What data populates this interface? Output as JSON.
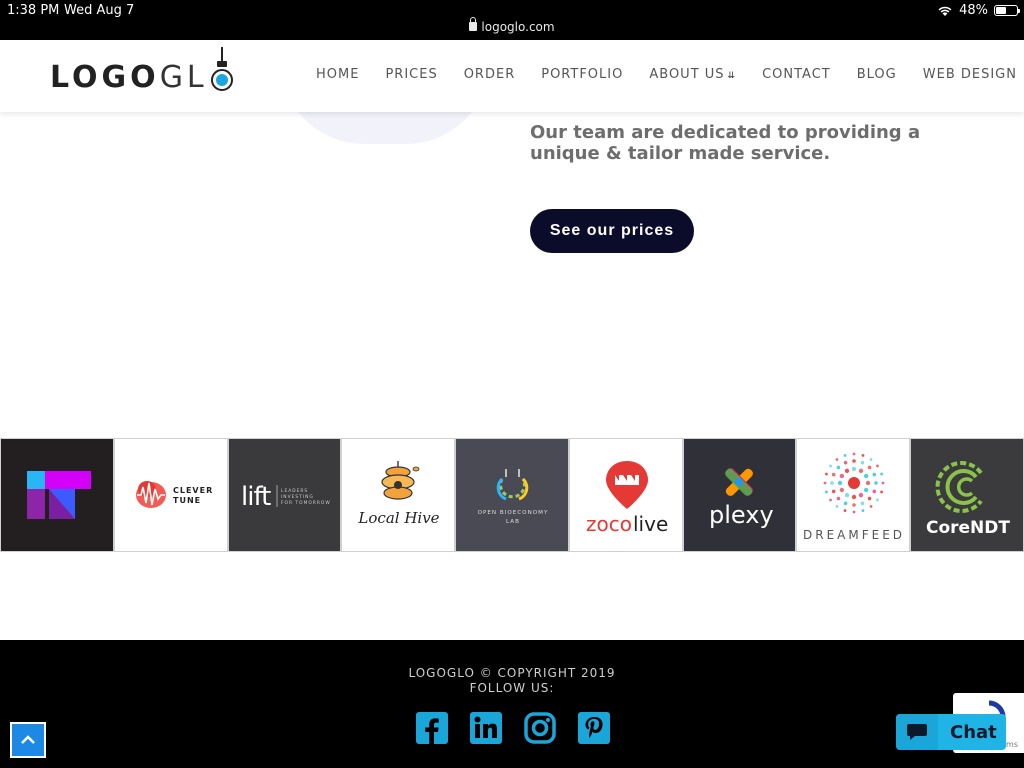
{
  "status_bar": {
    "time": "1:38 PM",
    "date": "Wed Aug 7",
    "url": "logoglo.com",
    "battery": "48%",
    "battery_level": 0.48
  },
  "header": {
    "logo_bold": "LOGO",
    "logo_light": "GL",
    "nav": [
      {
        "label": "HOME"
      },
      {
        "label": "PRICES"
      },
      {
        "label": "ORDER"
      },
      {
        "label": "PORTFOLIO"
      },
      {
        "label": "ABOUT US",
        "has_dropdown": true
      },
      {
        "label": "CONTACT"
      },
      {
        "label": "BLOG"
      },
      {
        "label": "WEB DESIGN"
      }
    ]
  },
  "hero": {
    "tagline": "Our team are dedicated to providing a unique & tailor made service.",
    "cta_label": "See our prices"
  },
  "portfolio_logos": [
    {
      "name": "IT",
      "bg": "#231f20"
    },
    {
      "name": "CLEVER TUNE",
      "bg": "#ffffff"
    },
    {
      "name": "lift",
      "sub": "LEADERS INVESTING FOR TOMORROW",
      "bg": "#3a3a3c"
    },
    {
      "name": "Local Hive",
      "bg": "#ffffff"
    },
    {
      "name": "OPEN BIOECONOMY LAB",
      "bg": "#4a4a55"
    },
    {
      "name": "zocolive",
      "bg": "#ffffff"
    },
    {
      "name": "plexy",
      "bg": "#2f3038"
    },
    {
      "name": "DREAMFEED",
      "bg": "#ffffff"
    },
    {
      "name": "CoreNDT",
      "bg": "#3b3b3d"
    }
  ],
  "footer": {
    "copyright": "LOGOGLO © COPYRIGHT 2019",
    "follow": "FOLLOW US:",
    "socials": [
      "facebook-icon",
      "linkedin-icon",
      "instagram-icon",
      "pinterest-icon"
    ]
  },
  "widgets": {
    "chat_label": "Chat",
    "recaptcha_text": "Terms"
  },
  "colors": {
    "accent": "#1fb3e6",
    "cta_bg": "#0b0b2a",
    "footer_bg": "#000000"
  }
}
